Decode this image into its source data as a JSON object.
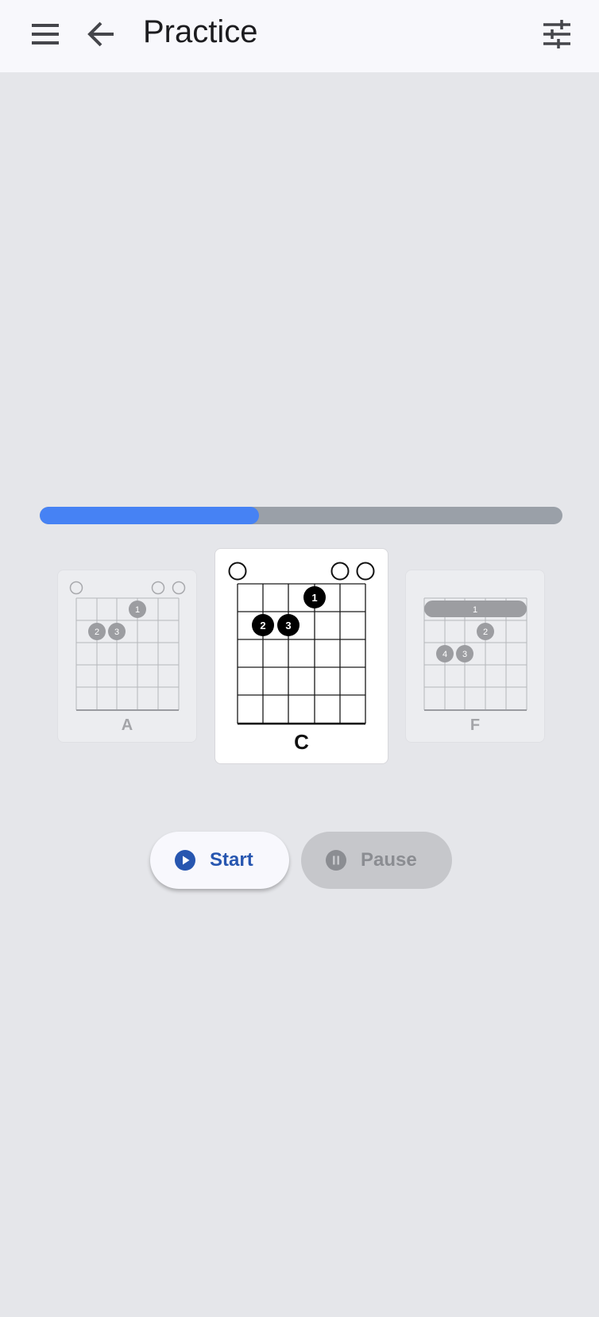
{
  "app_bar": {
    "title": "Practice",
    "menu_icon": "menu-icon",
    "back_icon": "arrow-back-icon",
    "settings_icon": "tune-icon"
  },
  "progress": {
    "value": 0.42,
    "fill_color": "#4682f4",
    "track_color": "#9aa0a8"
  },
  "chords": {
    "previous": {
      "name": "A",
      "open_strings": [
        "1",
        "5",
        "6"
      ],
      "fingers": [
        {
          "finger": "1",
          "string": "4",
          "fret": "1"
        },
        {
          "finger": "2",
          "string": "2",
          "fret": "2"
        },
        {
          "finger": "3",
          "string": "3",
          "fret": "2"
        }
      ]
    },
    "current": {
      "name": "C",
      "open_strings": [
        "1",
        "5",
        "6"
      ],
      "fingers": [
        {
          "finger": "1",
          "string": "4",
          "fret": "1"
        },
        {
          "finger": "2",
          "string": "2",
          "fret": "2"
        },
        {
          "finger": "3",
          "string": "3",
          "fret": "2"
        }
      ]
    },
    "next": {
      "name": "F",
      "barre": {
        "finger": "1",
        "fret": "1"
      },
      "fingers": [
        {
          "finger": "2",
          "string": "4",
          "fret": "2"
        },
        {
          "finger": "4",
          "string": "2",
          "fret": "3"
        },
        {
          "finger": "3",
          "string": "3",
          "fret": "3"
        }
      ]
    }
  },
  "controls": {
    "start_label": "Start",
    "pause_label": "Pause",
    "start_icon": "play-circle-icon",
    "pause_icon": "pause-circle-icon"
  }
}
